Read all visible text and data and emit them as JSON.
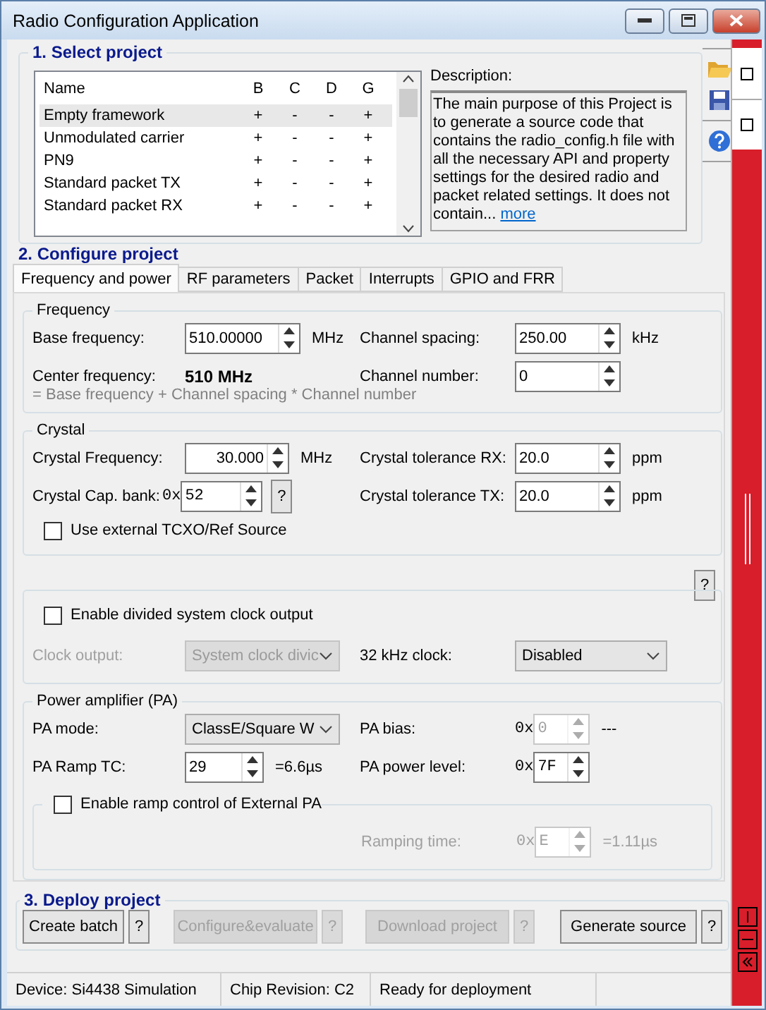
{
  "window": {
    "title": "Radio Configuration Application"
  },
  "select_project": {
    "title": "1. Select project",
    "columns": [
      "Name",
      "B",
      "C",
      "D",
      "G"
    ],
    "rows": [
      {
        "cells": [
          "Empty framework",
          "+",
          "-",
          "-",
          "+"
        ],
        "selected": true
      },
      {
        "cells": [
          "Unmodulated carrier",
          "+",
          "-",
          "-",
          "+"
        ],
        "selected": false
      },
      {
        "cells": [
          "PN9",
          "+",
          "-",
          "-",
          "+"
        ],
        "selected": false
      },
      {
        "cells": [
          "Standard packet TX",
          "+",
          "-",
          "-",
          "+"
        ],
        "selected": false
      },
      {
        "cells": [
          "Standard packet RX",
          "+",
          "-",
          "-",
          "+"
        ],
        "selected": false
      }
    ],
    "description_label": "Description:",
    "description": "The main purpose of this Project is to generate a source code that contains the radio_config.h file with all the necessary API and property settings for the desired radio and packet related settings. It does not contain...",
    "more_link": "more"
  },
  "configure": {
    "title": "2. Configure project",
    "tabs": [
      {
        "label": "Frequency and power",
        "selected": true
      },
      {
        "label": "RF parameters",
        "selected": false
      },
      {
        "label": "Packet",
        "selected": false
      },
      {
        "label": "Interrupts",
        "selected": false
      },
      {
        "label": "GPIO and FRR",
        "selected": false
      }
    ],
    "frequency": {
      "title": "Frequency",
      "base": {
        "label": "Base frequency:",
        "value": "510.00000",
        "unit": "MHz"
      },
      "spacing": {
        "label": "Channel spacing:",
        "value": "250.00",
        "unit": "kHz"
      },
      "center": {
        "label": "Center frequency:",
        "value": "510 MHz"
      },
      "channel": {
        "label": "Channel number:",
        "value": "0"
      },
      "formula": "= Base frequency + Channel spacing * Channel number"
    },
    "crystal": {
      "title": "Crystal",
      "freq": {
        "label": "Crystal Frequency:",
        "value": "30.000",
        "unit": "MHz"
      },
      "tol_rx": {
        "label": "Crystal tolerance RX:",
        "value": "20.0",
        "unit": "ppm"
      },
      "cap": {
        "label": "Crystal Cap. bank:",
        "prefix": "0x",
        "value": "52",
        "help": "?"
      },
      "tol_tx": {
        "label": "Crystal tolerance TX:",
        "value": "20.0",
        "unit": "ppm"
      },
      "tcxo": {
        "label": "Use external TCXO/Ref Source",
        "checked": false
      }
    },
    "clock": {
      "help": "?",
      "enable": {
        "label": "Enable divided system clock output",
        "checked": false
      },
      "output": {
        "label": "Clock output:",
        "value": "System clock divic",
        "disabled": true
      },
      "khz": {
        "label": "32 kHz clock:",
        "value": "Disabled",
        "disabled": false
      }
    },
    "pa": {
      "title": "Power amplifier (PA)",
      "mode": {
        "label": "PA mode:",
        "value": "ClassE/Square W",
        "disabled": false
      },
      "bias": {
        "label": "PA bias:",
        "prefix": "0x",
        "value": "0",
        "note": "---",
        "disabled": true
      },
      "ramp_tc": {
        "label": "PA Ramp TC:",
        "value": "29",
        "note": "=6.6µs"
      },
      "power": {
        "label": "PA power level:",
        "prefix": "0x",
        "value": "7F",
        "disabled": false
      },
      "ext_ramp": {
        "label": "Enable ramp control of External PA",
        "checked": false
      },
      "ramping_time": {
        "label": "Ramping time:",
        "prefix": "0x",
        "value": "E",
        "note": "=1.11µs",
        "disabled": true
      }
    }
  },
  "deploy": {
    "title": "3. Deploy project",
    "buttons": [
      {
        "label": "Create batch",
        "help": "?",
        "disabled": false
      },
      {
        "label": "Configure&evaluate",
        "help": "?",
        "disabled": true
      },
      {
        "label": "Download project",
        "help": "?",
        "disabled": true
      },
      {
        "label": "Generate source",
        "help": "?",
        "disabled": false
      }
    ]
  },
  "status_bar": [
    "Device: Si4438  Simulation",
    "Chip Revision: C2",
    "Ready for deployment"
  ]
}
